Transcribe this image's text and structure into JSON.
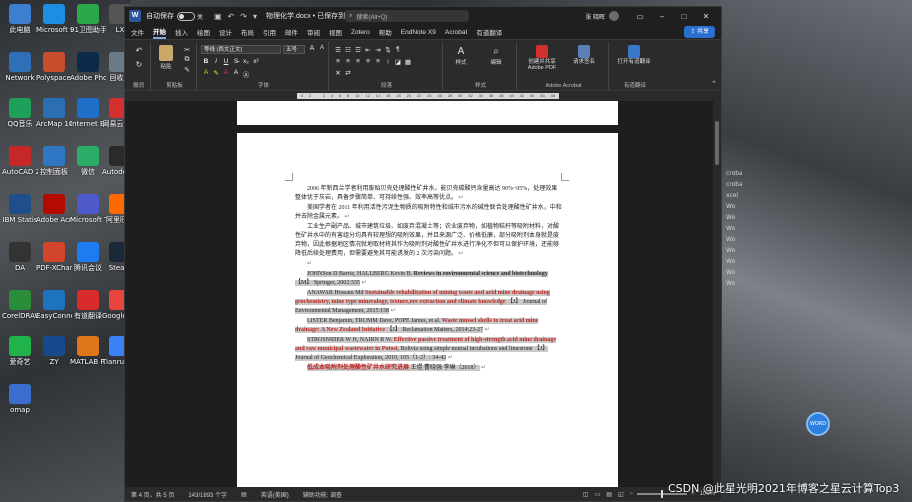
{
  "desktop": {
    "icons": [
      {
        "label": "此电脑",
        "color": "#3c7fd1"
      },
      {
        "label": "Microsoft Edge",
        "color": "#1d8fe3"
      },
      {
        "label": "91卫图助手",
        "color": "#2ba84a"
      },
      {
        "label": "LX",
        "color": "#555555"
      },
      {
        "label": "Network",
        "color": "#2f6fb8"
      },
      {
        "label": "Polyspace R2018a",
        "color": "#c84d2b"
      },
      {
        "label": "Adobe Photoshop",
        "color": "#0e2a4a"
      },
      {
        "label": "回收站",
        "color": "#6c7a86"
      },
      {
        "label": "QQ音乐",
        "color": "#1e9f5a"
      },
      {
        "label": "ArcMap 10.8",
        "color": "#2c6eb2"
      },
      {
        "label": "Internet Explorer",
        "color": "#1d6fc7"
      },
      {
        "label": "网易云音乐",
        "color": "#d22f2f"
      },
      {
        "label": "AutoCAD 2022",
        "color": "#c62828"
      },
      {
        "label": "控制面板",
        "color": "#2f77c4"
      },
      {
        "label": "微信",
        "color": "#2aae67"
      },
      {
        "label": "Autodesk 桌面应用",
        "color": "#2a2a2a"
      },
      {
        "label": "IBM Statis",
        "color": "#1f4e8c"
      },
      {
        "label": "Adobe Acrobat DC",
        "color": "#b30b00"
      },
      {
        "label": "Microsoft Teams",
        "color": "#5059c9"
      },
      {
        "label": "阿里旺旺",
        "color": "#ff6a00"
      },
      {
        "label": "DA",
        "color": "#333333"
      },
      {
        "label": "PDF-XChange Viewer",
        "color": "#d0452c"
      },
      {
        "label": "腾讯会议",
        "color": "#1c7cf0"
      },
      {
        "label": "Steam",
        "color": "#1b2838"
      },
      {
        "label": "CorelDRAW 2019 (64-Bit)",
        "color": "#2a8d3a"
      },
      {
        "label": "EasyConnect",
        "color": "#1e73be"
      },
      {
        "label": "有道翻译",
        "color": "#d92b2b"
      },
      {
        "label": "Google Chrome",
        "color": "#e8453c"
      },
      {
        "label": "爱奇艺",
        "color": "#1fb34a"
      },
      {
        "label": "ZY",
        "color": "#174a8c"
      },
      {
        "label": "MATLAB R2018a",
        "color": "#e0761c"
      },
      {
        "label": "TianruoOCR",
        "color": "#3b82f6"
      },
      {
        "label": "omap",
        "color": "#3c6ed0"
      }
    ],
    "side_items": [
      "crobat",
      "crobat",
      "xcel",
      "Wo",
      "Wo",
      "Wo",
      "Wo",
      "Wo",
      "Wo",
      "Wo",
      "Wo"
    ],
    "float_button": "WORD",
    "watermark": "CSDN @此星光明2021年博客之星云计算Top3"
  },
  "word": {
    "autosave_label": "自动保存",
    "autosave_state": "关",
    "doc_title": "物理化学.docx • 已保存到这台电脑",
    "search_placeholder": "搜索(Alt+Q)",
    "user": "张 晓晖",
    "menu_tabs": [
      "文件",
      "开始",
      "插入",
      "绘图",
      "设计",
      "布局",
      "引用",
      "邮件",
      "审阅",
      "视图",
      "Zotero",
      "帮助",
      "EndNote X9",
      "Acrobat",
      "有道翻译"
    ],
    "active_tab": "开始",
    "share_label": "共享",
    "ribbon": {
      "undo_label": "撤消",
      "paste_label": "粘贴",
      "clipboard_label": "剪贴板",
      "font_name": "等线 (西文正文)",
      "font_size": "五号",
      "font_group": "字体",
      "bold": "B",
      "italic": "I",
      "underline": "U",
      "styles_label": "样式",
      "edit_label": "编辑",
      "paragraph_label": "段落",
      "style_group": "样式",
      "pdf_label": "创建并共享 Adobe PDF",
      "sign_label": "请求签名",
      "acrobat_group": "Adobe Acrobat",
      "translate_label": "打开有道翻译",
      "translate_group": "有道翻译"
    },
    "ruler_ticks": [
      "4",
      "2",
      "",
      "2",
      "4",
      "6",
      "8",
      "10",
      "12",
      "14",
      "16",
      "18",
      "20",
      "22",
      "24",
      "26",
      "28",
      "30",
      "32",
      "34",
      "36",
      "38",
      "40",
      "42",
      "44",
      "46",
      "48"
    ],
    "document": {
      "p1": "2006 年新西兰学者利用废贻贝壳处理酸性矿井水，能贝壳碳酸钙含量高达 90%~95%，处理效果整体优于灰岩，具备步骤简单、可持续性强、效率高等优点。",
      "p2": "美国学者在 2011 年利用活性污泥生物质的吸附特性和城市污水的碱性联合处理酸性矿井水，中和并去除金属元素。",
      "p3": "工业生产副产品、城市建筑垃圾、如废弃混凝土等；农业废弃物，如植物秸秆等吸附材料，对酸性矿井水中的有害组分均具有较理想的吸附效果，并且来源广泛、价格低廉，部分吸附剂本身就是废弃物，因此根据地区情况就地取材将其作为吸附剂对酸性矿井水进行净化不但可以保护环境，还能够降低后续处理费用，但需要避免其可能诱发的 2 次污染问题。",
      "refs": [
        {
          "a": "JOHNSon D Barrie, HALLBERG Kevin B. ",
          "t": "Reviews in environmental science and biotechnology",
          "r": " 【M】 Springer, 2002:335",
          "red": false
        },
        {
          "a": "ANAWAR Hossain Md ",
          "t": "Sustainable rehabilitation of mining waste and acid mine drainage using geochemistry, mine type mineralogy, texture,ore extraction and climate knowledge",
          "r": " 【J】 Journal of Environmental Management, 2015:158",
          "red": true
        },
        {
          "a": "LISTER Benjamin, TRUMM Dave, POPE James, et al. ",
          "t": "Waste mussel shells to treat acid mine drainage: A New Zealand Initiative",
          "r": " 【J】 Reclamation Matters, 2014:23-27",
          "red": true
        },
        {
          "a": "STROSNIDER W H, NAIRN R W. ",
          "t": "Effective passive treatment of high-strength acid mine drainage and raw municipal wastewater in Potosi",
          "r": ", Bolivia using simple mutual incubations and limestone 【J】 Journal of Geochemical Exploration, 2010, 105（1-2）: 34-42",
          "red": true
        },
        {
          "a": "",
          "t": "低成本吸附剂处理酸性矿井水研究进展",
          "r": " 王煜 曹晓强 李琳（2018）",
          "red": true
        }
      ]
    },
    "status": {
      "page": "第 4 页，共 5 页",
      "words": "143/1893 个字",
      "lang": "英语(美国)",
      "access": "辅助功能: 调查",
      "zoom": "100%"
    }
  }
}
